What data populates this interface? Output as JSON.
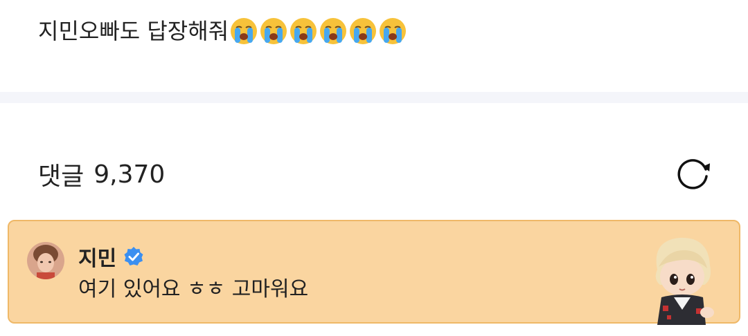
{
  "post": {
    "text": "지민오빠도 답장해줘",
    "emojis": [
      "loudly-crying-face-icon",
      "loudly-crying-face-icon",
      "loudly-crying-face-icon",
      "loudly-crying-face-icon",
      "loudly-crying-face-icon",
      "loudly-crying-face-icon"
    ]
  },
  "comments": {
    "label": "댓글",
    "count": "9,370",
    "refresh_icon": "refresh-icon"
  },
  "pinned_comment": {
    "author": "지민",
    "verified_icon": "verified-badge-icon",
    "text": "여기 있어요 ㅎㅎ 고마워요",
    "card_color": "#fad5a0",
    "border_color": "#efb867"
  },
  "colors": {
    "divider": "#f4f5fa",
    "verified": "#3b8ff0"
  }
}
